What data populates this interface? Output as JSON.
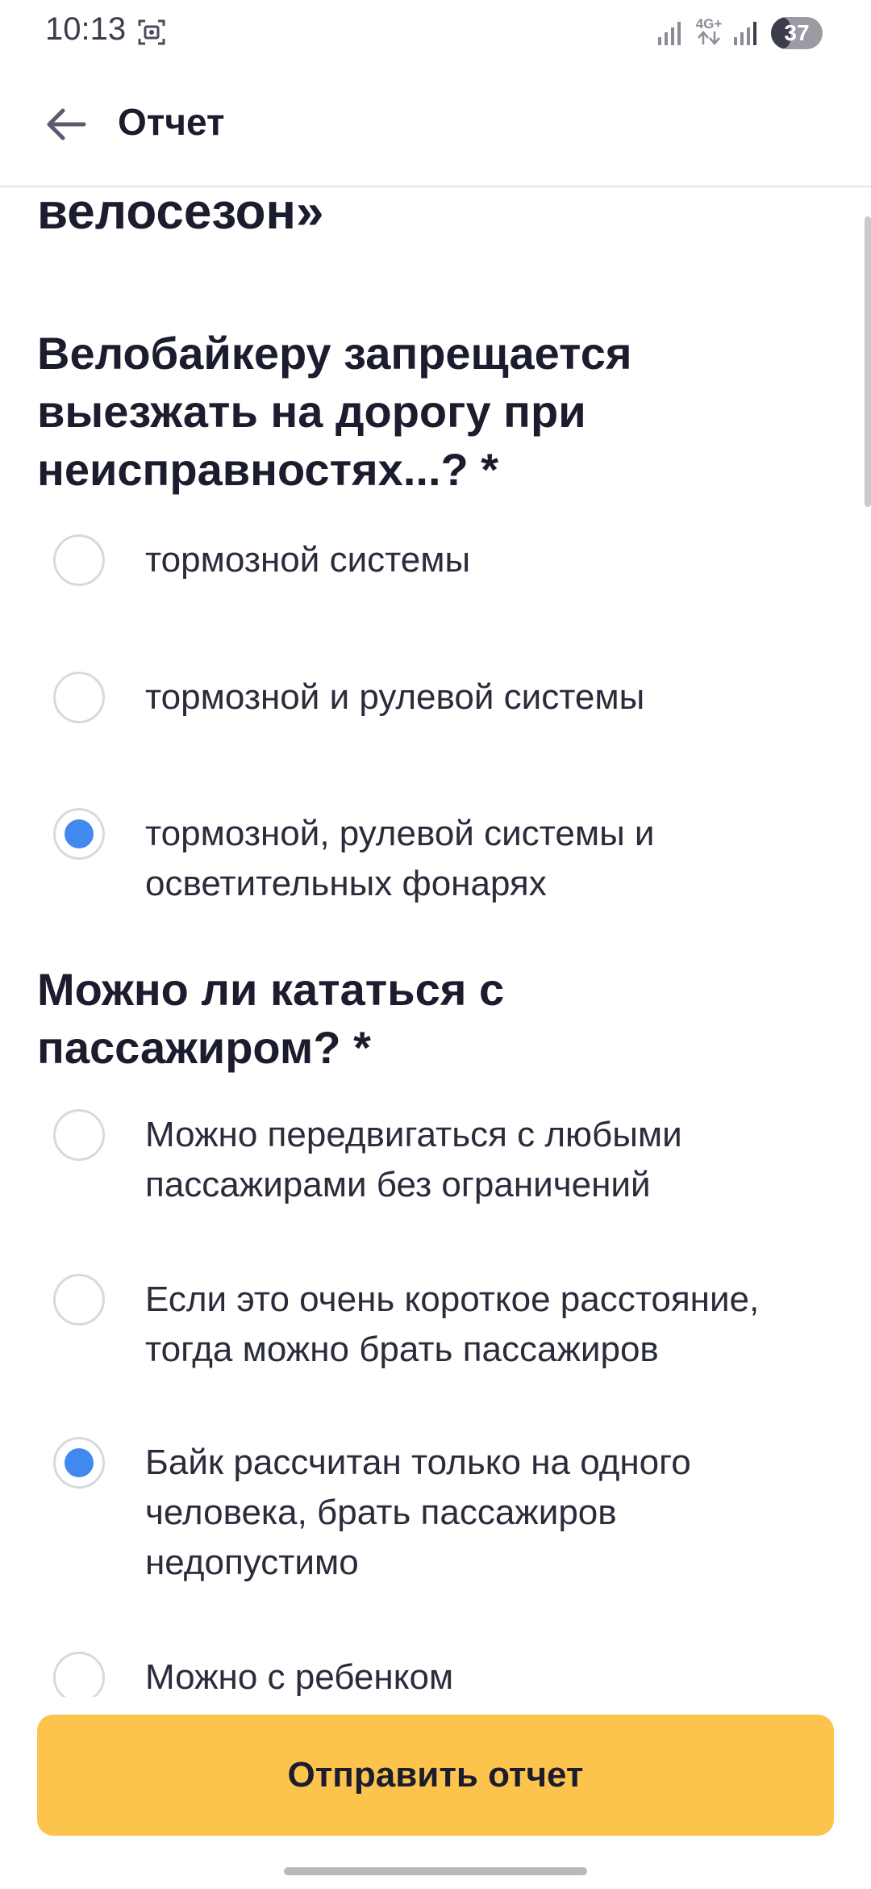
{
  "status_bar": {
    "time": "10:13",
    "network": "4G+",
    "battery": "37",
    "battery_level": 0.37
  },
  "app_bar": {
    "title": "Отчет"
  },
  "form": {
    "title_partial": "заданию «Безопасный велосезон»",
    "questions": [
      {
        "text": "Велобайкеру запрещается выезжать на дорогу при неисправностях...? *",
        "options": [
          {
            "label": "тормозной системы",
            "selected": false
          },
          {
            "label": "тормозной и рулевой системы",
            "selected": false
          },
          {
            "label": "тормозной, рулевой системы и осветительных фонарях",
            "selected": true
          }
        ]
      },
      {
        "text": "Можно ли кататься с пассажиром? *",
        "options": [
          {
            "label": "Можно передвигаться с любыми пассажирами без ограничений",
            "selected": false
          },
          {
            "label": "Если это очень короткое расстояние, тогда можно брать пассажиров",
            "selected": false
          },
          {
            "label": "Байк рассчитан только на одного человека, брать пассажиров недопустимо",
            "selected": true
          },
          {
            "label": "Можно с ребенком",
            "selected": false
          }
        ]
      }
    ]
  },
  "submit_label": "Отправить отчет",
  "colors": {
    "accent": "#fcc44c",
    "radio_selected": "#4289ef",
    "text": "#1b1c2e"
  }
}
